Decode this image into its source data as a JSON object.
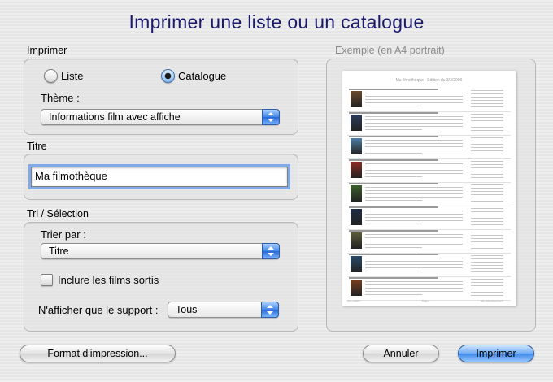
{
  "window_title": "Imprimer une liste ou un catalogue",
  "print_section": {
    "label": "Imprimer",
    "options": [
      {
        "label": "Liste",
        "selected": false
      },
      {
        "label": "Catalogue",
        "selected": true
      }
    ],
    "theme_label": "Thème :",
    "theme_value": "Informations film avec affiche"
  },
  "title_section": {
    "label": "Titre",
    "value": "Ma filmothèque"
  },
  "sort_section": {
    "label": "Tri / Sélection",
    "sort_label": "Trier par :",
    "sort_value": "Titre",
    "include_released_label": "Inclure les films sortis",
    "include_released_checked": false,
    "media_label": "N'afficher que le support :",
    "media_value": "Tous"
  },
  "preview": {
    "label": "Exemple (en A4 portrait)",
    "page_title": "Ma filmothèque - Edition du 3/3/2006",
    "footer_left": "Prnt. Gdlsrs",
    "footer_center": "Page 1",
    "footer_right": "http://filmothek.free.fr",
    "entries": [
      {
        "title": "007 / Et Rien que pour vos yeux (For Your Eyes Only)",
        "poster": "#6b4a2e"
      },
      {
        "title": "2001: L'odyssée de l'espace (2001: A Space Odyssey)",
        "poster": "#2c3d5a"
      },
      {
        "title": "Age de Glace (L') (Ice Age)",
        "poster": "#4f7fa8"
      },
      {
        "title": "Arme Fatale 3 (L') (LETHAL WEAPON)",
        "poster": "#8c2d23"
      },
      {
        "title": "Buzz l'éclair (Buzz Lightyear of Star Command)",
        "poster": "#3b5f2b"
      },
      {
        "title": "Contact (Contact)",
        "poster": "#1f2c46"
      },
      {
        "title": "Cube (Cube)",
        "poster": "#5a5a3a"
      },
      {
        "title": "I, Robot (I, Robot)",
        "poster": "#2a4a6a"
      },
      {
        "title": "Rush Hour (Rush Hour)",
        "poster": "#7a3d1f"
      }
    ]
  },
  "buttons": {
    "page_setup": "Format d'impression...",
    "cancel": "Annuler",
    "print": "Imprimer"
  },
  "colors": {
    "title": "#1a1a6e",
    "accent": "#3f84e8"
  }
}
